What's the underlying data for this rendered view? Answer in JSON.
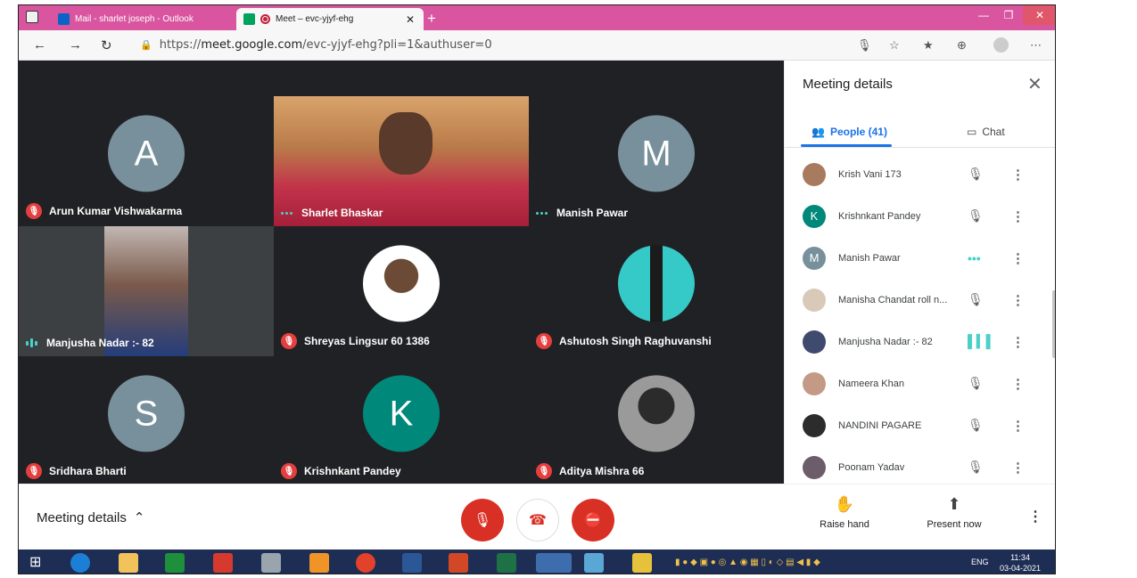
{
  "browser": {
    "tabs": [
      {
        "title": "Mail - sharlet joseph - Outlook",
        "active": false
      },
      {
        "title": "Meet – evc-yjyf-ehg",
        "active": true
      }
    ],
    "url_prefix": "https://",
    "url_host": "meet.google.com",
    "url_path": "/evc-yjyf-ehg?pli=1&authuser=0"
  },
  "tiles": [
    {
      "name": "Arun Kumar Vishwakarma",
      "status": "muted",
      "avatar_letter": "A",
      "avatar_color": "#78909c"
    },
    {
      "name": "Sharlet Bhaskar",
      "status": "active-dots",
      "video": true
    },
    {
      "name": "Manish Pawar",
      "status": "active-dots",
      "avatar_letter": "M",
      "avatar_color": "#78909c"
    },
    {
      "name": "Manjusha Nadar :- 82",
      "status": "speaking",
      "video": true
    },
    {
      "name": "Shreyas Lingsur 60 1386",
      "status": "muted",
      "photo": true
    },
    {
      "name": "Ashutosh Singh Raghuvanshi",
      "status": "muted",
      "photo": true
    },
    {
      "name": "Sridhara Bharti",
      "status": "muted",
      "avatar_letter": "S",
      "avatar_color": "#78909c"
    },
    {
      "name": "Krishnkant Pandey",
      "status": "muted",
      "avatar_letter": "K",
      "avatar_color": "#00897b"
    },
    {
      "name": "Aditya Mishra 66",
      "status": "muted",
      "photo": true
    }
  ],
  "panel": {
    "title": "Meeting details",
    "people_tab": "People (41)",
    "chat_tab": "Chat",
    "people": [
      {
        "name": "Krish Vani 173",
        "status": "muted",
        "avatar": "photo"
      },
      {
        "name": "Krishnkant Pandey",
        "status": "muted",
        "avatar_letter": "K",
        "avatar_color": "#00897b"
      },
      {
        "name": "Manish Pawar",
        "status": "active-dots",
        "avatar_letter": "M",
        "avatar_color": "#78909c"
      },
      {
        "name": "Manisha Chandat roll n...",
        "status": "muted",
        "avatar": "photo"
      },
      {
        "name": "Manjusha Nadar :- 82",
        "status": "speaking",
        "avatar": "photo"
      },
      {
        "name": "Nameera Khan",
        "status": "muted",
        "avatar": "photo"
      },
      {
        "name": "NANDINI PAGARE",
        "status": "muted",
        "avatar": "photo"
      },
      {
        "name": "Poonam Yadav",
        "status": "muted",
        "avatar": "photo"
      }
    ]
  },
  "bottom": {
    "meeting_details": "Meeting details",
    "raise_hand": "Raise hand",
    "present_now": "Present now"
  },
  "taskbar": {
    "lang": "ENG",
    "time": "11:34",
    "date": "03-04-2021"
  }
}
